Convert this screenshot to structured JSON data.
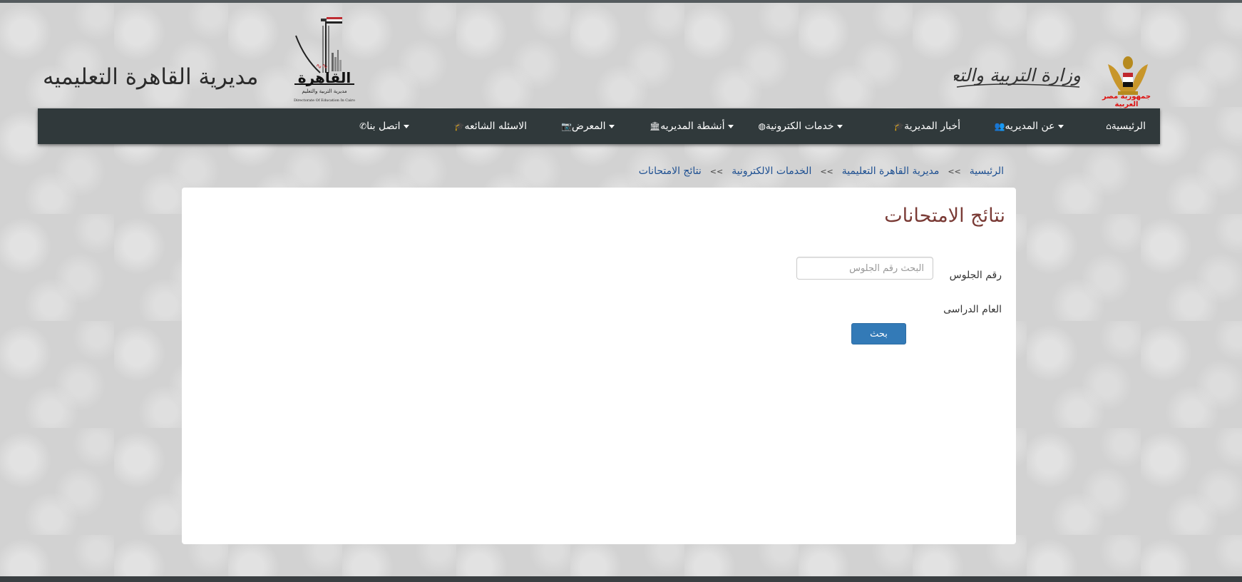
{
  "header": {
    "site_title": "مديرية القاهرة التعليميه",
    "ministry_text": "وزارة التربية والتعليم",
    "country_caption": "جمهورية مصر العربية",
    "cairo_logo_title": "القاهرة",
    "cairo_logo_subtitle": "مديرية التربية والتعليم",
    "cairo_logo_en": "Directorate Of Education In Cairo"
  },
  "nav": {
    "items": [
      {
        "label": "الرئيسية",
        "icon": "home-icon",
        "dropdown": false
      },
      {
        "label": "عن المديريه",
        "icon": "users-icon",
        "dropdown": true
      },
      {
        "label": "أخبار المديرية",
        "icon": "graduation-cap-icon",
        "dropdown": false
      },
      {
        "label": "خدمات الكترونية",
        "icon": "globe-icon",
        "dropdown": true
      },
      {
        "label": "أنشطة المديريه",
        "icon": "institution-icon",
        "dropdown": true
      },
      {
        "label": "المعرض",
        "icon": "camera-icon",
        "dropdown": true
      },
      {
        "label": "الاسئله الشائعه",
        "icon": "graduation-cap-icon",
        "dropdown": false
      },
      {
        "label": "اتصل بنا",
        "icon": "phone-icon",
        "dropdown": true
      }
    ]
  },
  "breadcrumb": {
    "items": [
      "الرئيسية",
      "مديرية القاهرة التعليمية",
      "الخدمات الالكترونية",
      "نتائج الامتحانات"
    ],
    "separator": ">>"
  },
  "main": {
    "title": "نتائج الامتحانات",
    "seat_label": "رقم الجلوس",
    "seat_placeholder": "البحث رقم الجلوس",
    "seat_value": "",
    "year_label": "العام الدراسى",
    "search_button": "بحث"
  },
  "colors": {
    "nav_bg": "#30393b",
    "title": "#7a3b36",
    "link": "#1d4f91",
    "button": "#337ab7"
  }
}
